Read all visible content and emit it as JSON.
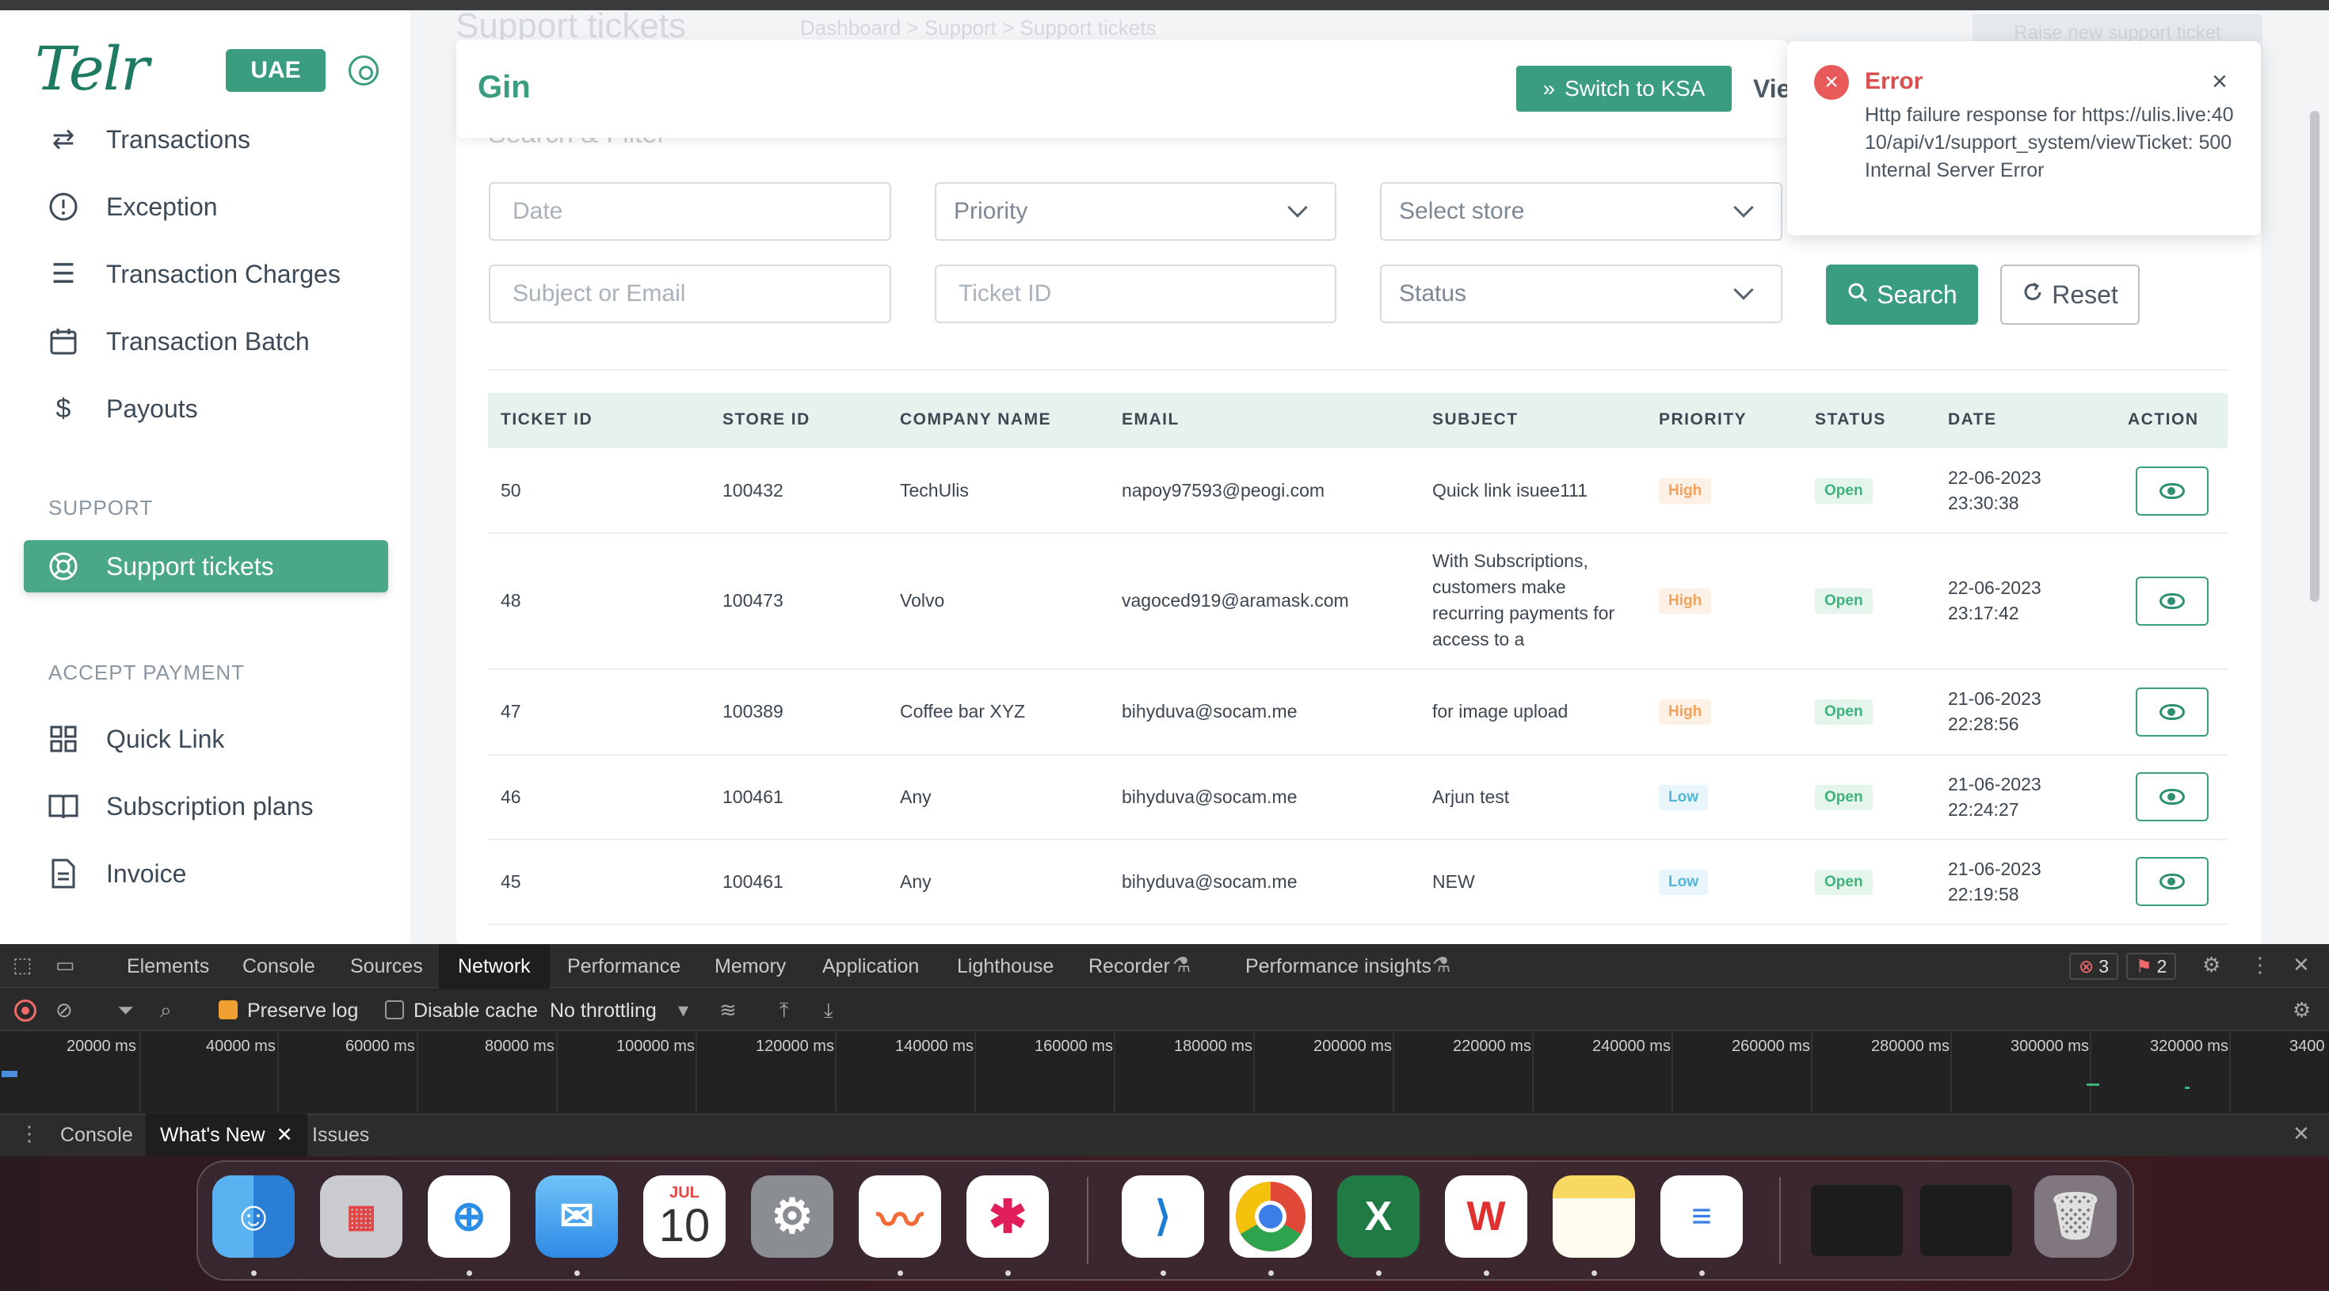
{
  "sidebar": {
    "logo": "Telr",
    "region": "UAE",
    "items_main": [
      {
        "label": "Transactions",
        "icon": "arrows-exchange-icon"
      },
      {
        "label": "Exception",
        "icon": "alert-circle-icon"
      },
      {
        "label": "Transaction Charges",
        "icon": "list-icon"
      },
      {
        "label": "Transaction Batch",
        "icon": "calendar-icon"
      },
      {
        "label": "Payouts",
        "icon": "dollar-icon"
      }
    ],
    "support_label": "SUPPORT",
    "support_item": "Support tickets",
    "accept_label": "ACCEPT PAYMENT",
    "items_accept": [
      {
        "label": "Quick Link",
        "icon": "grid-icon"
      },
      {
        "label": "Subscription plans",
        "icon": "book-icon"
      },
      {
        "label": "Invoice",
        "icon": "document-icon"
      }
    ]
  },
  "background": {
    "page_title": "Support tickets",
    "breadcrumb": "Dashboard  >  Support  >  Support tickets",
    "raise_button": "Raise new support ticket",
    "filter_title": "Search & Filter"
  },
  "header": {
    "title": "Gin",
    "switch_button": "Switch to KSA",
    "view_partial": "Vie"
  },
  "toast": {
    "title": "Error",
    "message": "Http failure response for https://ulis.live:4010/api/v1/support_system/viewTicket: 500 Internal Server Error",
    "color": "#e85a5a"
  },
  "filters": {
    "date_placeholder": "Date",
    "priority_placeholder": "Priority",
    "store_placeholder": "Select store",
    "subject_placeholder": "Subject or Email",
    "ticket_placeholder": "Ticket ID",
    "status_placeholder": "Status",
    "search_button": "Search",
    "reset_button": "Reset"
  },
  "table": {
    "headers": [
      "TICKET ID",
      "STORE ID",
      "COMPANY NAME",
      "EMAIL",
      "SUBJECT",
      "PRIORITY",
      "STATUS",
      "DATE",
      "ACTION"
    ],
    "rows": [
      {
        "ticket_id": "50",
        "store_id": "100432",
        "company": "TechUlis",
        "email": "napoy97593@peogi.com",
        "subject": "Quick link isuee111",
        "priority": "High",
        "status": "Open",
        "date": "22-06-2023",
        "time": "23:30:38"
      },
      {
        "ticket_id": "48",
        "store_id": "100473",
        "company": "Volvo",
        "email": "vagoced919@aramask.com",
        "subject": "With Subscriptions, customers make recurring payments for access to a",
        "priority": "High",
        "status": "Open",
        "date": "22-06-2023",
        "time": "23:17:42"
      },
      {
        "ticket_id": "47",
        "store_id": "100389",
        "company": "Coffee bar XYZ",
        "email": "bihyduva@socam.me",
        "subject": "for image upload",
        "priority": "High",
        "status": "Open",
        "date": "21-06-2023",
        "time": "22:28:56"
      },
      {
        "ticket_id": "46",
        "store_id": "100461",
        "company": "Any",
        "email": "bihyduva@socam.me",
        "subject": "Arjun test",
        "priority": "Low",
        "status": "Open",
        "date": "21-06-2023",
        "time": "22:24:27"
      },
      {
        "ticket_id": "45",
        "store_id": "100461",
        "company": "Any",
        "email": "bihyduva@socam.me",
        "subject": "NEW",
        "priority": "Low",
        "status": "Open",
        "date": "21-06-2023",
        "time": "22:19:58"
      }
    ]
  },
  "devtools": {
    "tabs": [
      "Elements",
      "Console",
      "Sources",
      "Network",
      "Performance",
      "Memory",
      "Application",
      "Lighthouse",
      "Recorder",
      "Performance insights"
    ],
    "active_tab": "Network",
    "error_count": "3",
    "warning_count": "2",
    "preserve_log": "Preserve log",
    "disable_cache": "Disable cache",
    "throttling": "No throttling",
    "ticks": [
      "20000 ms",
      "40000 ms",
      "60000 ms",
      "80000 ms",
      "100000 ms",
      "120000 ms",
      "140000 ms",
      "160000 ms",
      "180000 ms",
      "200000 ms",
      "220000 ms",
      "240000 ms",
      "260000 ms",
      "280000 ms",
      "300000 ms",
      "320000 ms",
      "3400"
    ],
    "drawer_tabs": [
      "Console",
      "What's New",
      "Issues"
    ],
    "drawer_active": "What's New"
  },
  "dock": {
    "calendar_month": "JUL",
    "calendar_day": "10"
  }
}
